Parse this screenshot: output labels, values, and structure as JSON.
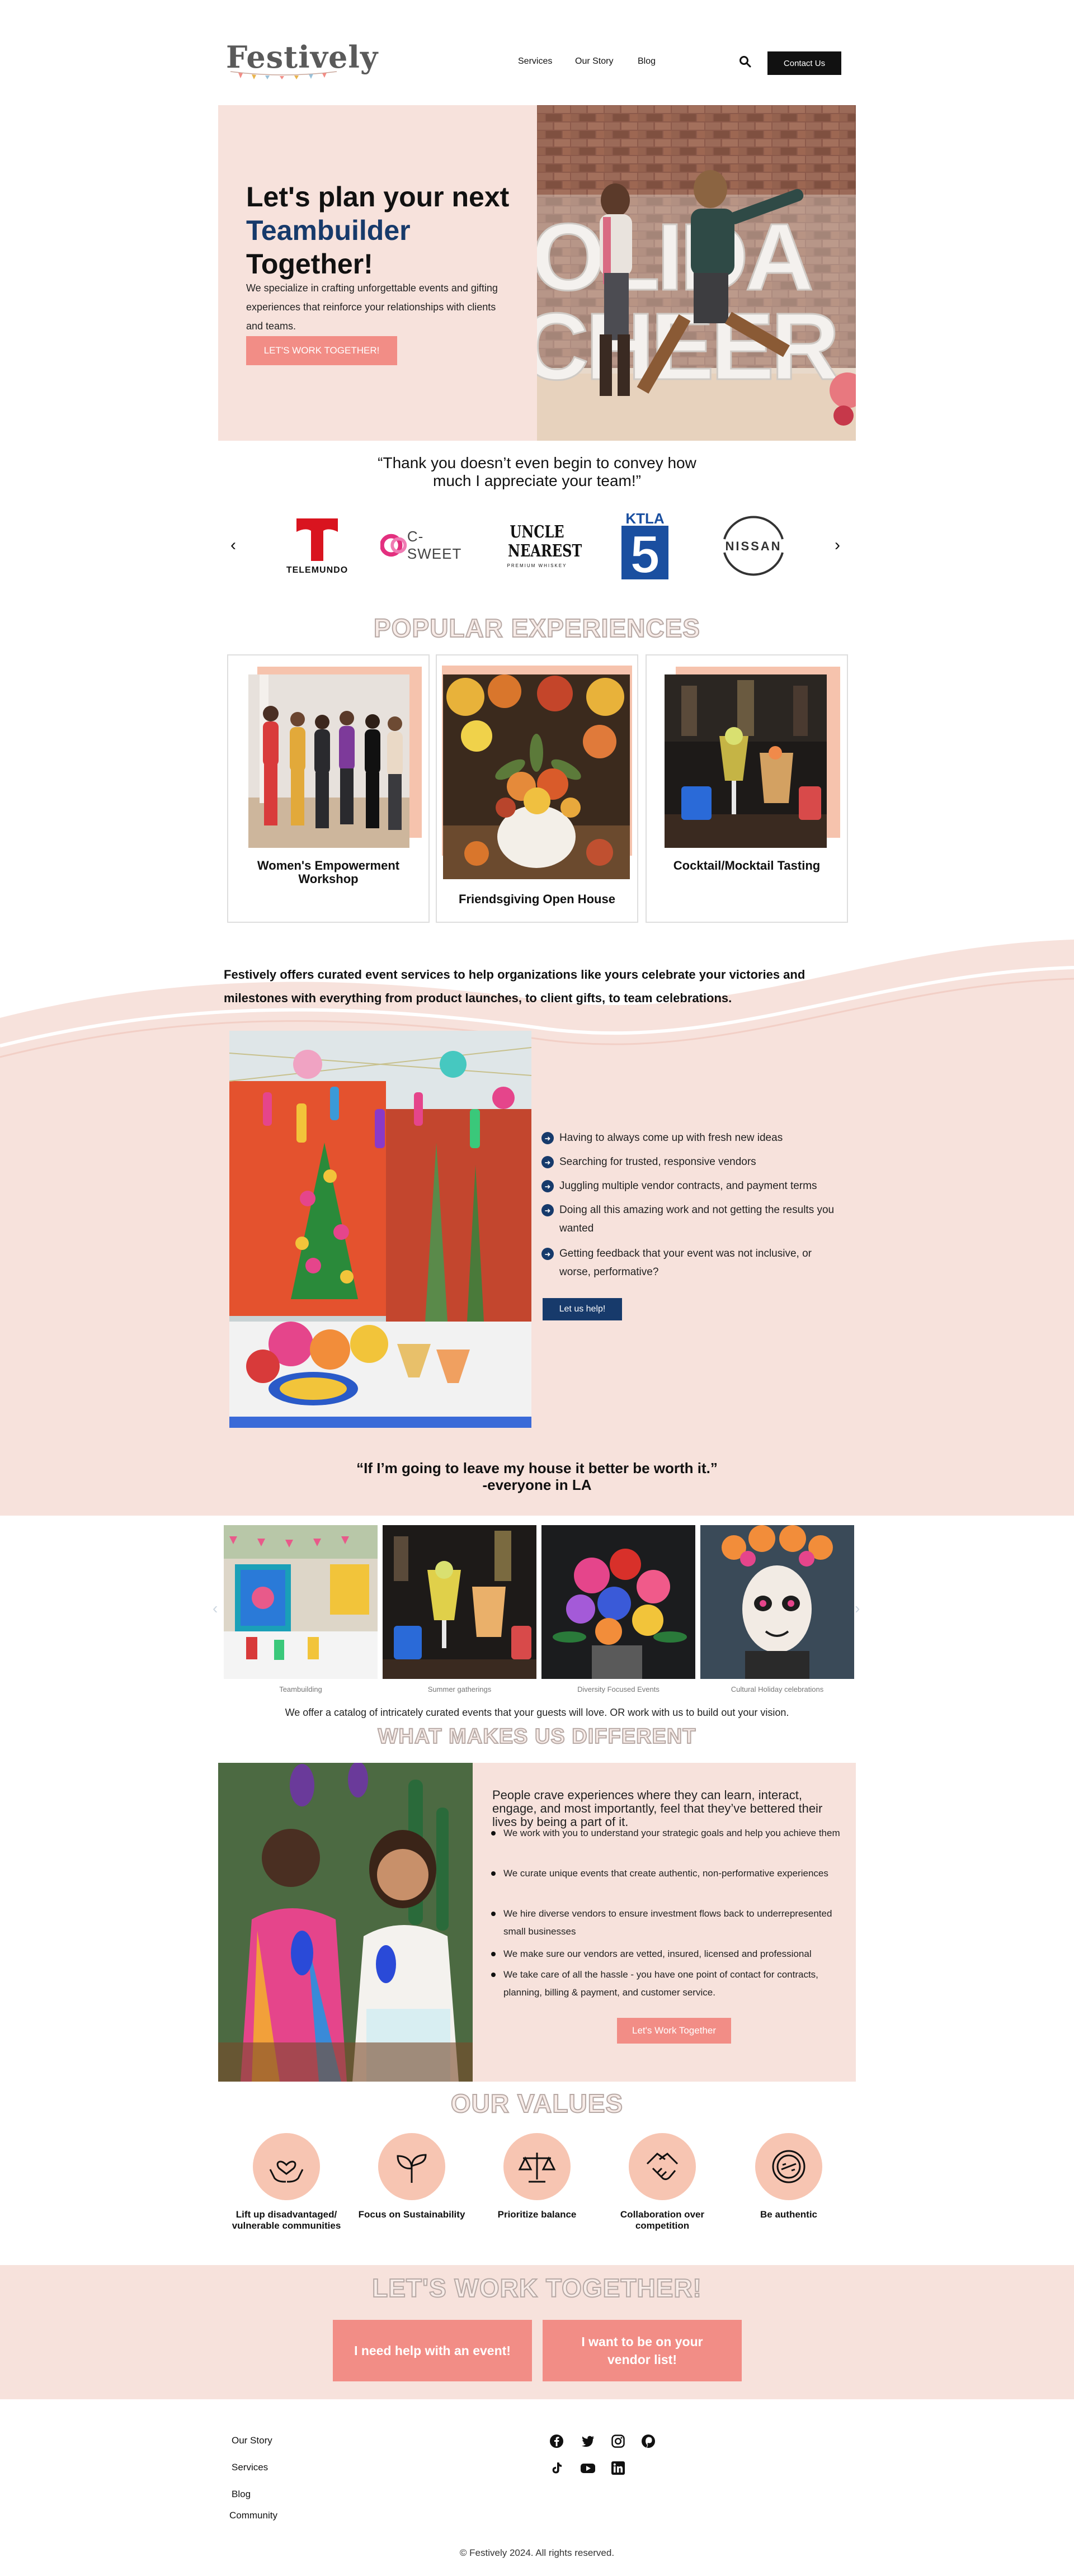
{
  "header": {
    "logo": "Festively",
    "nav": [
      "Services",
      "Our Story",
      "Blog"
    ],
    "search_icon": "search-icon",
    "contact_label": "Contact Us"
  },
  "hero": {
    "title_line1": "Let's plan your next",
    "title_accent": "Teambuilder",
    "title_line3": "Together!",
    "description": "We specialize in crafting unforgettable events and gifting experiences that reinforce your relationships with clients and teams.",
    "cta": "LET'S WORK TOGETHER!",
    "photo_sign_text": "HOLIDAY CHEER"
  },
  "testimonial": "“Thank you doesn’t even begin to convey how much I appreciate your team!”",
  "logos": {
    "prev_icon": "chevron-left-icon",
    "next_icon": "chevron-right-icon",
    "items": [
      {
        "name": "TELEMUNDO",
        "mark": "T"
      },
      {
        "name": "C-SWEET",
        "mark": "C"
      },
      {
        "name": "UNCLE NEAREST",
        "sub": "PREMIUM WHISKEY"
      },
      {
        "name": "KTLA",
        "mark": "5"
      },
      {
        "name": "NISSAN"
      }
    ]
  },
  "popular": {
    "title": "POPULAR EXPERIENCES",
    "cards": [
      {
        "label": "Women's Empowerment Workshop"
      },
      {
        "label": "Friendsgiving Open House"
      },
      {
        "label": "Cocktail/Mocktail Tasting"
      }
    ]
  },
  "about": {
    "brand": "Festively",
    "text": " offers curated event services to help organizations like yours celebrate your victories and milestones with everything from product launches, to client gifts, to team celebrations."
  },
  "pain_points": {
    "items": [
      "Having to always come up with fresh new ideas",
      "Searching for trusted, responsive vendors",
      "Juggling multiple vendor contracts, and payment terms",
      "Doing all this amazing work and not getting the results you wanted",
      "Getting feedback that your event was not inclusive, or worse, performative?"
    ],
    "cta": "Let us help!"
  },
  "quote": {
    "line1": "“If I’m going to leave my house it better be worth it.”",
    "line2": "-everyone in LA"
  },
  "gallery": {
    "captions": [
      "Teambuilding",
      "Summer gatherings",
      "Diversity Focused Events",
      "Cultural Holiday celebrations"
    ],
    "note": "We offer a catalog of intricately curated events that your guests will love. OR work with us to build out your vision."
  },
  "different": {
    "title": "WHAT MAKES US DIFFERENT",
    "lead": "People crave experiences where they can learn, interact, engage, and most importantly, feel that they’ve bettered their lives by being a part of it.",
    "items": [
      "We work with you to understand your strategic goals and help you achieve them",
      "We curate unique events that create authentic, non-performative experiences",
      "We hire diverse vendors to ensure investment flows back to underrepresented small businesses",
      "We make sure our vendors are vetted, insured, licensed and professional",
      "We take care of all the hassle - you have one point of contact for contracts, planning, billing & payment, and customer service."
    ],
    "cta": "Let's Work Together"
  },
  "values": {
    "title": "OUR VALUES",
    "items": [
      {
        "label": "Lift up disadvantaged/ vulnerable communities",
        "icon": "heart-hands-icon"
      },
      {
        "label": "Focus on Sustainability",
        "icon": "sprout-icon"
      },
      {
        "label": "Prioritize balance",
        "icon": "scale-icon"
      },
      {
        "label": "Collaboration over competition",
        "icon": "handshake-icon"
      },
      {
        "label": "Be authentic",
        "icon": "badge-icon"
      }
    ]
  },
  "cta_section": {
    "title": "LET'S WORK TOGETHER!",
    "btn_event": "I need help with an event!",
    "btn_vendor": "I want to be on your vendor list!"
  },
  "footer": {
    "links": [
      "Our Story",
      "Services",
      "Blog",
      "Community"
    ],
    "social": [
      "facebook-icon",
      "twitter-icon",
      "instagram-icon",
      "pinterest-icon",
      "tiktok-icon",
      "youtube-icon",
      "linkedin-icon"
    ],
    "copyright": "© Festively 2024. All rights reserved."
  },
  "colors": {
    "accent_navy": "#173a6b",
    "accent_coral": "#f28d86",
    "blush_bg": "#f7e2dc",
    "peach": "#f7c5b2"
  }
}
